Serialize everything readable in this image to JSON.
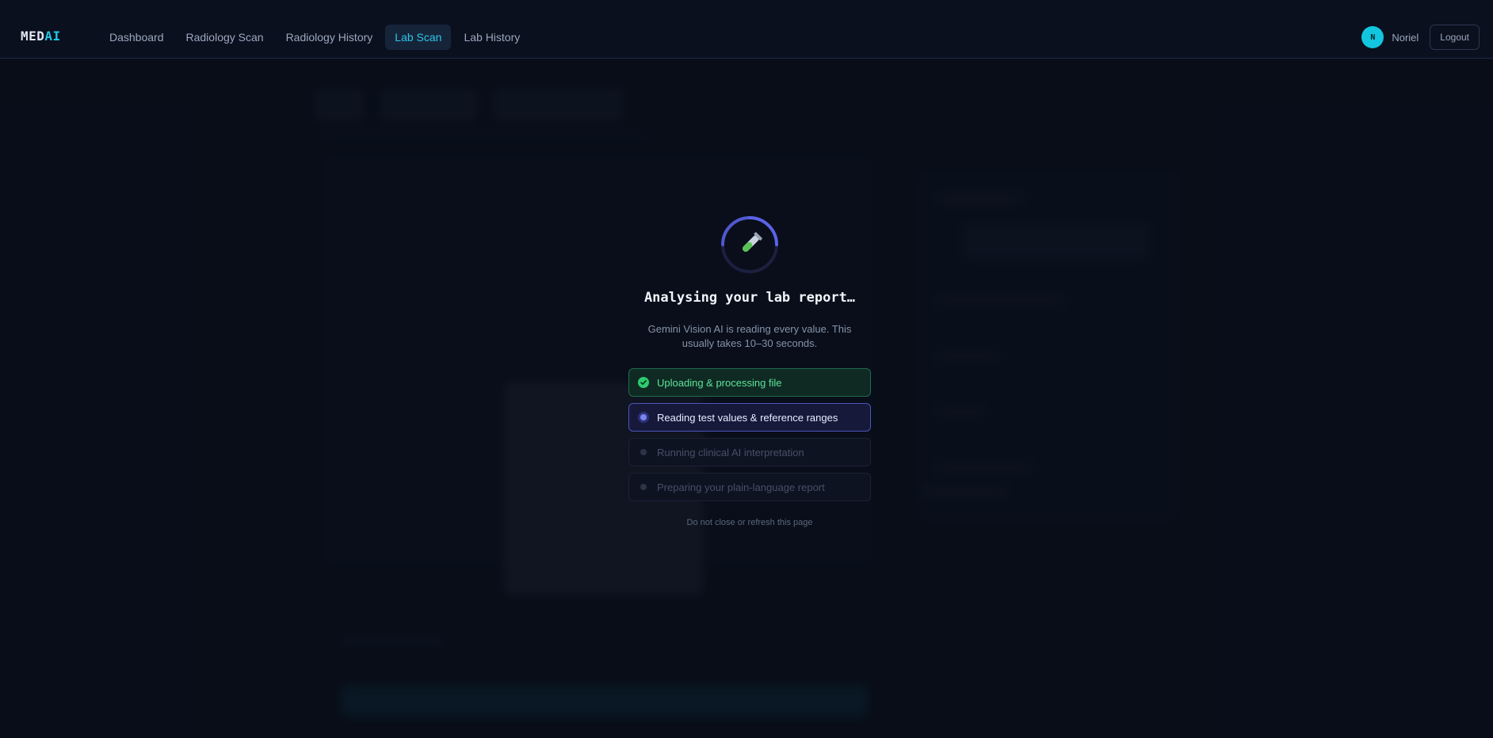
{
  "nav": {
    "logo_part1": "MED",
    "logo_part2": "AI",
    "links": [
      {
        "label": "Dashboard",
        "active": false
      },
      {
        "label": "Radiology Scan",
        "active": false
      },
      {
        "label": "Radiology History",
        "active": false
      },
      {
        "label": "Lab Scan",
        "active": true
      },
      {
        "label": "Lab History",
        "active": false
      }
    ],
    "user_initial": "N",
    "user_name": "Noriel",
    "logout_label": "Logout"
  },
  "loader": {
    "icon": "test-tube-icon",
    "title": "Analysing your lab report…",
    "description": "Gemini Vision AI is reading every value. This usually takes 10–30 seconds.",
    "steps": [
      {
        "label": "Uploading & processing file",
        "status": "done"
      },
      {
        "label": "Reading test values & reference ranges",
        "status": "active"
      },
      {
        "label": "Running clinical AI interpretation",
        "status": "pending"
      },
      {
        "label": "Preparing your plain-language report",
        "status": "pending"
      }
    ],
    "note": "Do not close or refresh this page"
  },
  "colors": {
    "accent": "#1ec8e6",
    "success": "#2ecb6f",
    "progress": "#5b63e6",
    "background": "#0a0f1c"
  }
}
